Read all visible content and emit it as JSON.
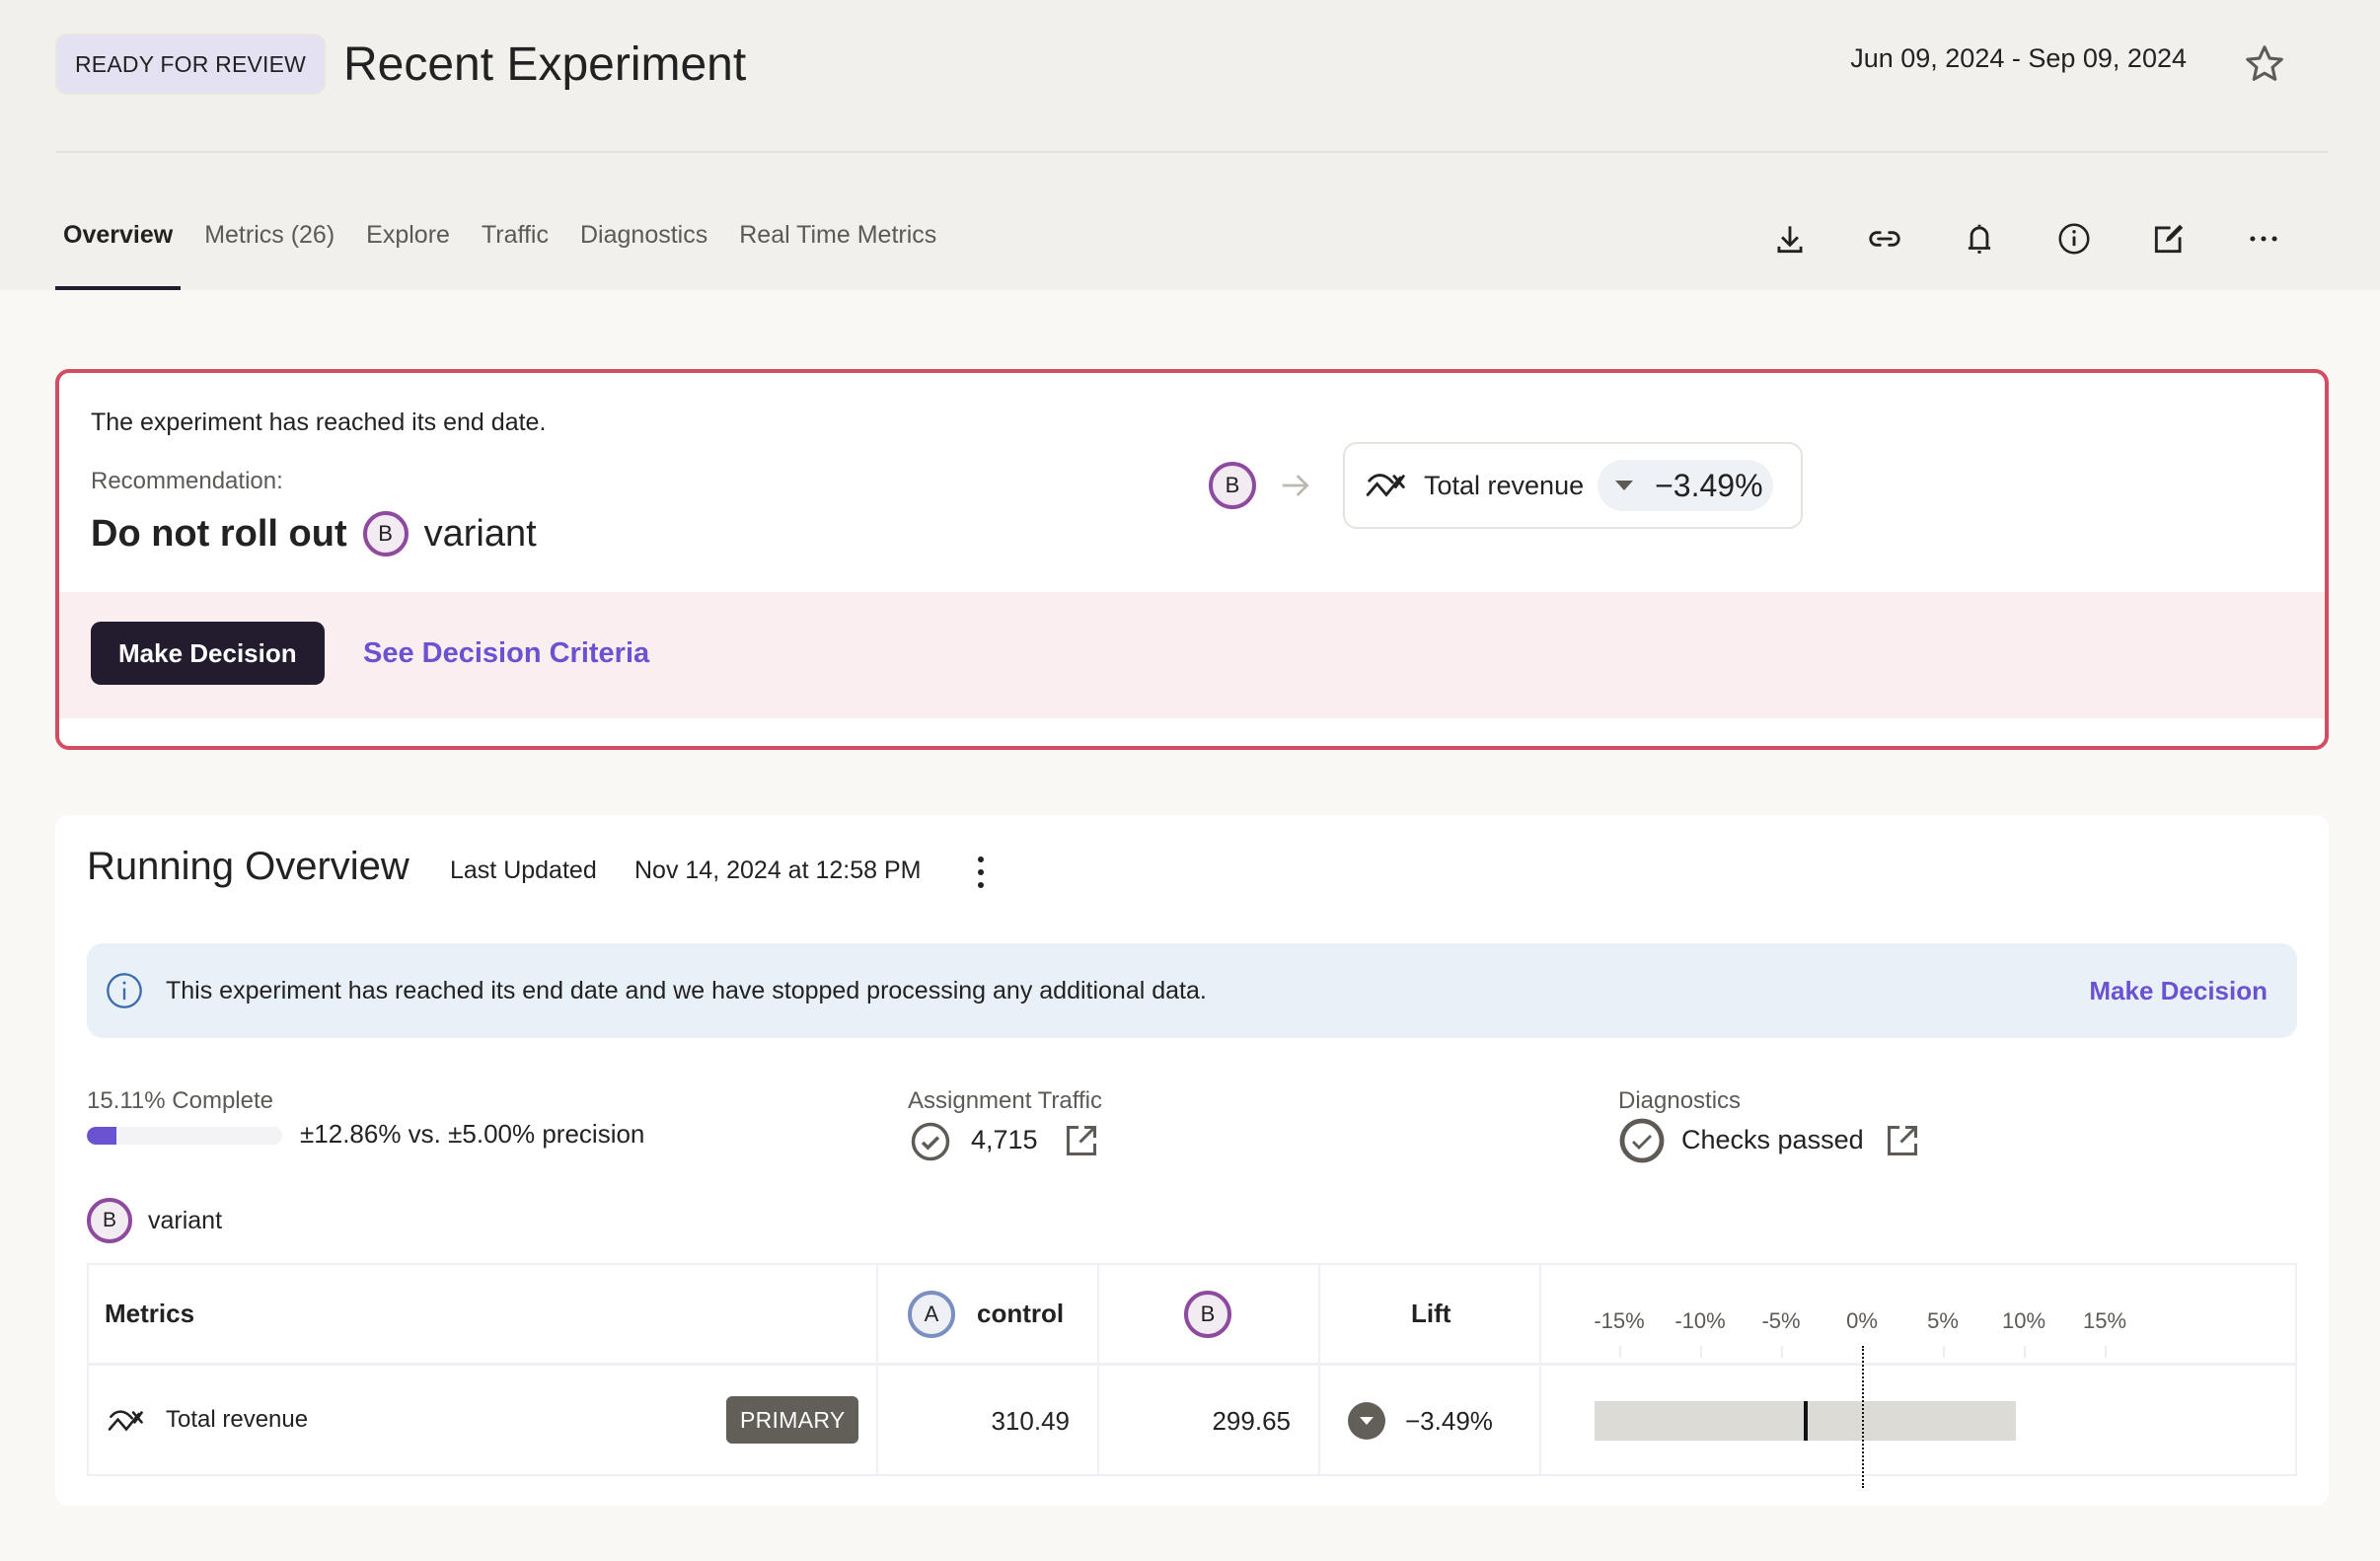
{
  "header": {
    "status_badge": "READY FOR REVIEW",
    "title": "Recent Experiment",
    "date_range": "Jun 09, 2024 - Sep 09, 2024",
    "favorite_icon": "star-outline-icon"
  },
  "tabs": [
    {
      "label": "Overview",
      "active": true
    },
    {
      "label": "Metrics (26)",
      "active": false
    },
    {
      "label": "Explore",
      "active": false
    },
    {
      "label": "Traffic",
      "active": false
    },
    {
      "label": "Diagnostics",
      "active": false
    },
    {
      "label": "Real Time Metrics",
      "active": false
    }
  ],
  "toolbar": {
    "icons": [
      "download-icon",
      "link-icon",
      "bell-icon",
      "info-icon",
      "edit-icon",
      "more-horizontal-icon"
    ]
  },
  "recommendation": {
    "status_text": "The experiment has reached its end date.",
    "label": "Recommendation:",
    "action": "Do not roll out",
    "variant_letter": "B",
    "variant_word": "variant",
    "metric": {
      "variant_letter": "B",
      "name": "Total revenue",
      "direction": "down",
      "lift": "−3.49%"
    },
    "make_decision_label": "Make Decision",
    "criteria_link_label": "See Decision Criteria"
  },
  "running_overview": {
    "title": "Running Overview",
    "last_updated_label": "Last Updated",
    "last_updated_value": "Nov 14, 2024 at 12:58 PM",
    "banner": {
      "message": "This experiment has reached its end date and we have stopped processing any additional data.",
      "action_label": "Make Decision"
    },
    "completion": {
      "label": "15.11% Complete",
      "percent": 15.11,
      "precision_text": "±12.86% vs. ±5.00% precision"
    },
    "assignment_traffic": {
      "label": "Assignment Traffic",
      "value": "4,715",
      "status": "ok"
    },
    "diagnostics": {
      "label": "Diagnostics",
      "value": "Checks passed",
      "status": "ok"
    },
    "variant_selector": {
      "letter": "B",
      "label": "variant"
    },
    "table": {
      "headers": {
        "metrics": "Metrics",
        "control_letter": "A",
        "control": "control",
        "treatment_letter": "B",
        "lift": "Lift"
      },
      "axis_ticks": [
        "-15%",
        "-10%",
        "-5%",
        "0%",
        "5%",
        "10%",
        "15%"
      ],
      "axis_tick_values": [
        -15,
        -10,
        -5,
        0,
        5,
        10,
        15
      ],
      "rows": [
        {
          "metric": "Total revenue",
          "badge": "PRIMARY",
          "control": "310.49",
          "treatment": "299.65",
          "lift": "−3.49%",
          "lift_direction": "down",
          "lift_value": -3.49,
          "ci_low": -16.5,
          "ci_high": 9.5
        }
      ]
    }
  },
  "colors": {
    "accent": "#6a52d0",
    "alert_border": "#d24c62",
    "variant_b": "#8e4a9e",
    "variant_a": "#7b8fc0",
    "dark_button": "#221c2e"
  }
}
